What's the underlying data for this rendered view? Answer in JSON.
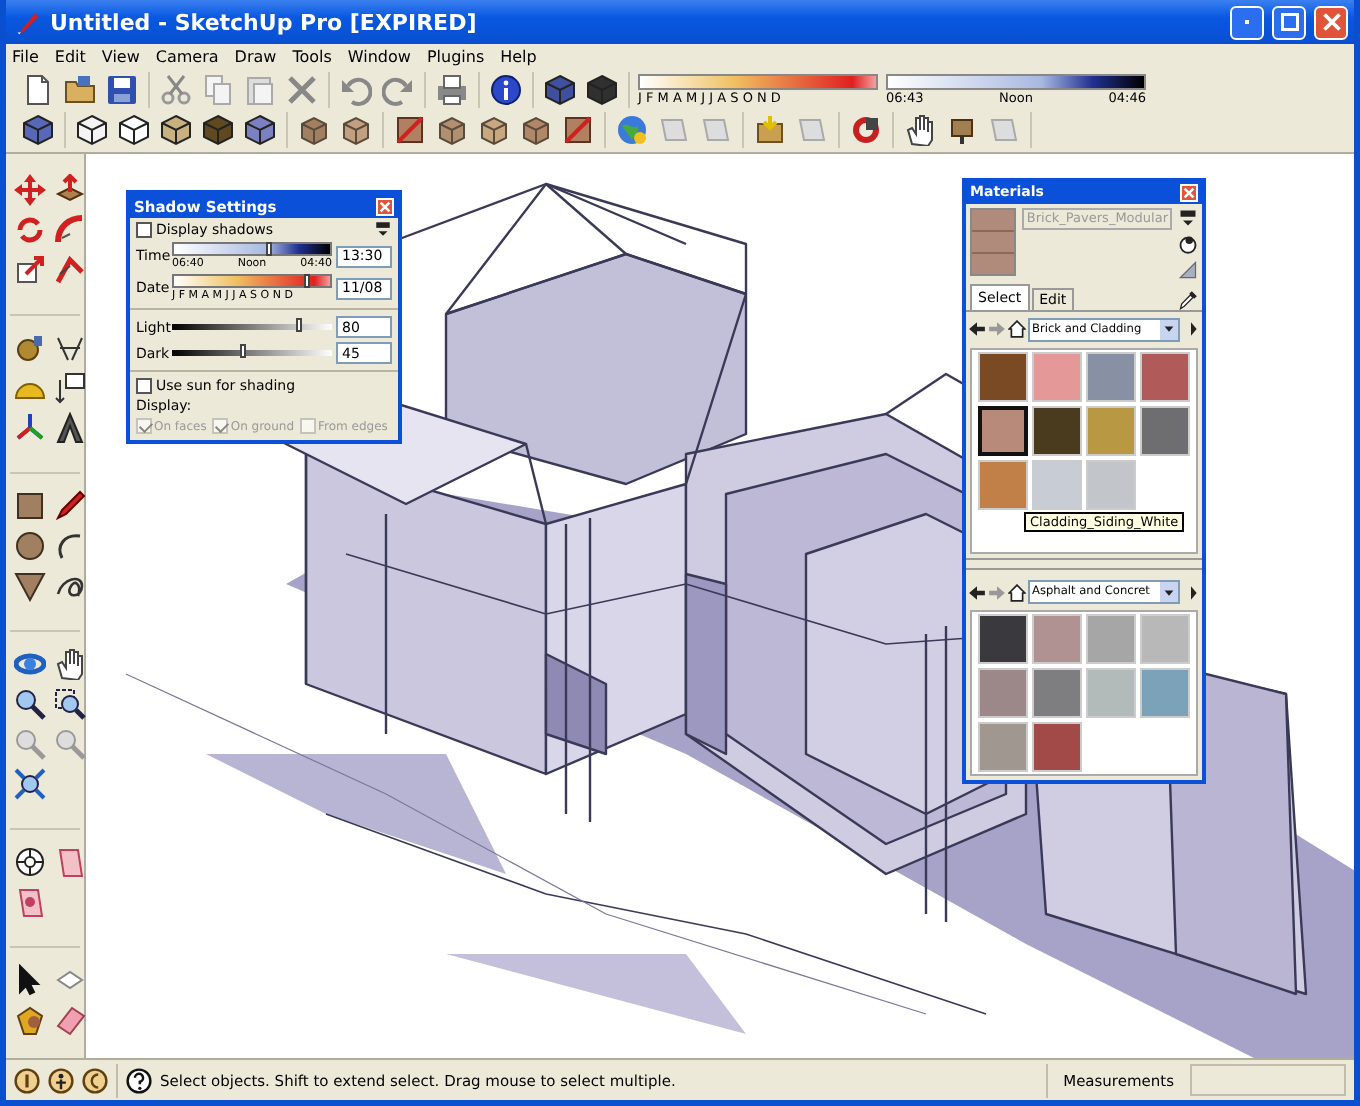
{
  "window": {
    "title": "Untitled - SketchUp Pro [EXPIRED]"
  },
  "menu": [
    "File",
    "Edit",
    "View",
    "Camera",
    "Draw",
    "Tools",
    "Window",
    "Plugins",
    "Help"
  ],
  "shadow_toolbar": {
    "months": "J F M A M J J A S O N D",
    "time_labels": [
      "06:43",
      "Noon",
      "04:46"
    ]
  },
  "shadow_settings": {
    "title": "Shadow Settings",
    "display_shadows": {
      "label": "Display shadows",
      "checked": false
    },
    "time": {
      "label": "Time",
      "scale": [
        "06:40",
        "Noon",
        "04:40"
      ],
      "level": 0.62,
      "value": "13:30"
    },
    "date": {
      "label": "Date",
      "months": "J F M A M J J A S O N D",
      "level": 0.86,
      "value": "11/08"
    },
    "light": {
      "label": "Light",
      "level": 0.8,
      "value": "80"
    },
    "dark": {
      "label": "Dark",
      "level": 0.45,
      "value": "45"
    },
    "use_sun": {
      "label": "Use sun for shading",
      "checked": false
    },
    "display_label": "Display:",
    "display_options": [
      {
        "label": "On faces",
        "checked": true,
        "disabled": true
      },
      {
        "label": "On ground",
        "checked": true,
        "disabled": true
      },
      {
        "label": "From edges",
        "checked": false,
        "disabled": true
      }
    ]
  },
  "materials": {
    "title": "Materials",
    "name": "Brick_Pavers_Modular",
    "tabs": [
      {
        "label": "Select",
        "selected": true
      },
      {
        "label": "Edit",
        "selected": false
      }
    ],
    "library": "Brick and Cladding",
    "swatches": [
      {
        "color": "#7a4a24",
        "selected": false
      },
      {
        "color": "#e49898",
        "selected": false
      },
      {
        "color": "#8890a4",
        "selected": false
      },
      {
        "color": "#b05a5a",
        "selected": false
      },
      {
        "color": "#b88a7a",
        "selected": true
      },
      {
        "color": "#4a3a1e",
        "selected": false
      },
      {
        "color": "#b89842",
        "selected": false
      },
      {
        "color": "#6e6e70",
        "selected": false
      },
      {
        "color": "#c08048",
        "selected": false
      },
      {
        "color": "#c8ccd4",
        "selected": false
      },
      {
        "color": "#c2c6ca",
        "selected": false
      }
    ],
    "tooltip": "Cladding_Siding_White",
    "library_2": "Asphalt and Concret",
    "swatches_2": [
      {
        "color": "#3a3a3e",
        "selected": false
      },
      {
        "color": "#b09292",
        "selected": false
      },
      {
        "color": "#a6a6a6",
        "selected": false
      },
      {
        "color": "#b8b8b8",
        "selected": false
      },
      {
        "color": "#9c8888",
        "selected": false
      },
      {
        "color": "#7e7e80",
        "selected": false
      },
      {
        "color": "#b2baba",
        "selected": false
      },
      {
        "color": "#7ca2ba",
        "selected": false
      },
      {
        "color": "#a09890",
        "selected": false
      },
      {
        "color": "#a24a48",
        "selected": false
      }
    ]
  },
  "status_bar": {
    "hint": "Select objects. Shift to extend select. Drag mouse to select multiple.",
    "measurements_label": "Measurements"
  }
}
